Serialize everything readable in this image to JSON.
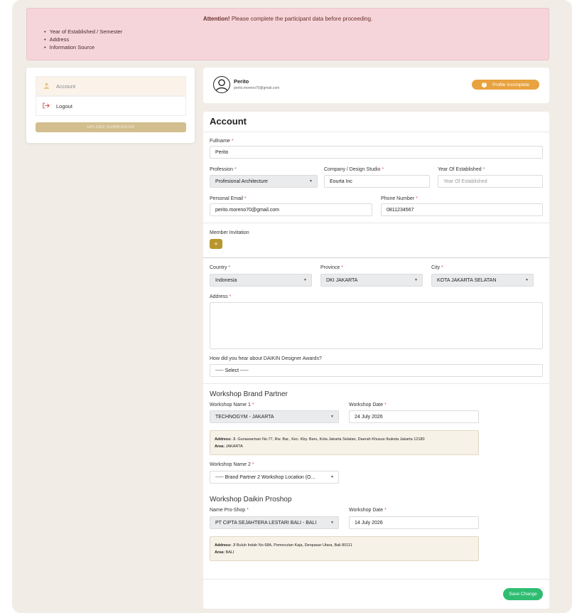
{
  "alert": {
    "title": "Attention!",
    "message": " Please complete the participant data before proceeding.",
    "items": [
      "Year of Established / Semester",
      "Address",
      "Information Source"
    ]
  },
  "sidebar": {
    "items": [
      {
        "label": "Account",
        "icon": "user-icon"
      },
      {
        "label": "Logout",
        "icon": "logout-icon"
      }
    ],
    "upload_label": "UPLOAD SUBMISSION"
  },
  "profile": {
    "name": "Perito",
    "email": "perito.moreno70@gmail.com",
    "status": "Profile Incomplete",
    "status_icon": "!"
  },
  "form": {
    "title": "Account",
    "fullname": {
      "label": "Fullname",
      "value": "Perito"
    },
    "profession": {
      "label": "Profession",
      "value": "Profesional Architecture"
    },
    "company": {
      "label": "Company / Design Studio",
      "value": "Eourta Inc"
    },
    "year": {
      "label": "Year Of Established",
      "placeholder": "Year Of Established"
    },
    "email": {
      "label": "Personal Email",
      "value": "perito.moreno70@gmail.com"
    },
    "phone": {
      "label": "Phone Number",
      "value": "0811234567"
    },
    "member_invitation": {
      "label": "Member Invitation",
      "button": "+"
    },
    "country": {
      "label": "Country",
      "value": "Indonesia"
    },
    "province": {
      "label": "Province",
      "value": "DKI JAKARTA"
    },
    "city": {
      "label": "City",
      "value": "KOTA JAKARTA SELATAN"
    },
    "address": {
      "label": "Address"
    },
    "source": {
      "label": "How did you hear about DAIKIN Designer Awards?",
      "value": "----- Select -----"
    },
    "required_mark": "*"
  },
  "brand_partner": {
    "title": "Workshop Brand Partner",
    "name1_label": "Workshop Name 1",
    "name1_value": "TECHNOGYM - JAKARTA",
    "date_label": "Workshop Date",
    "date_value": "24 July 2026",
    "address_label": "Address:",
    "address_value": " Jl. Gunawarman No.77, Rw. Bar., Kec. Kby. Baru, Kota Jakarta Selatan, Daerah Khusus Ibukota Jakarta 12180",
    "area_label": "Area:",
    "area_value": " JAKARTA",
    "name2_label": "Workshop Name 2",
    "name2_value": "----- Brand Partner 2 Workshop Location (O..."
  },
  "proshop": {
    "title": "Workshop Daikin Proshop",
    "name_label": "Name Pro-Shop",
    "name_value": "PT CIPTA SEJAHTERA LESTARI BALI - BALI",
    "date_label": "Workshop Date",
    "date_value": "14 July 2026",
    "address_label": "Address:",
    "address_value": " Jl Buluh Indah No 68A, Pemecutan Kaja, Denpasar Utara, Bali 80111",
    "area_label": "Area:",
    "area_value": " BALI"
  },
  "save_label": "Save Change"
}
